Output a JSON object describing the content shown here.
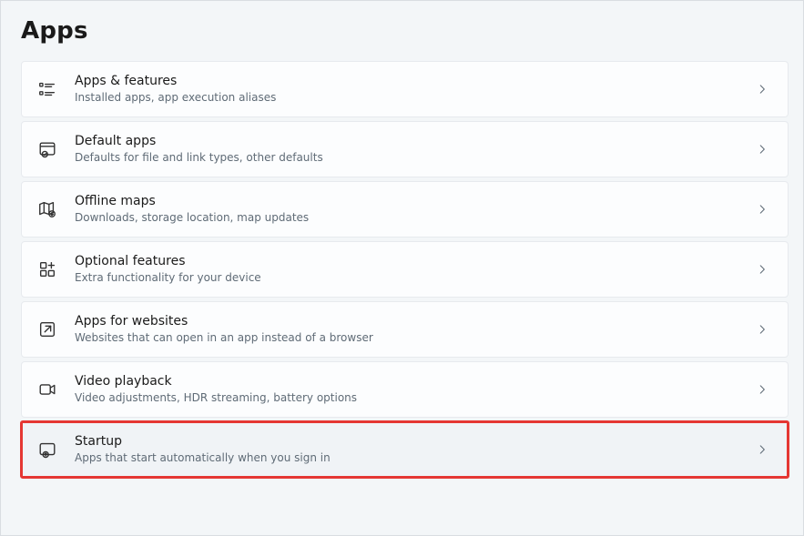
{
  "page": {
    "title": "Apps"
  },
  "rows": [
    {
      "title": "Apps & features",
      "subtitle": "Installed apps, app execution aliases"
    },
    {
      "title": "Default apps",
      "subtitle": "Defaults for file and link types, other defaults"
    },
    {
      "title": "Offline maps",
      "subtitle": "Downloads, storage location, map updates"
    },
    {
      "title": "Optional features",
      "subtitle": "Extra functionality for your device"
    },
    {
      "title": "Apps for websites",
      "subtitle": "Websites that can open in an app instead of a browser"
    },
    {
      "title": "Video playback",
      "subtitle": "Video adjustments, HDR streaming, battery options"
    },
    {
      "title": "Startup",
      "subtitle": "Apps that start automatically when you sign in"
    }
  ]
}
